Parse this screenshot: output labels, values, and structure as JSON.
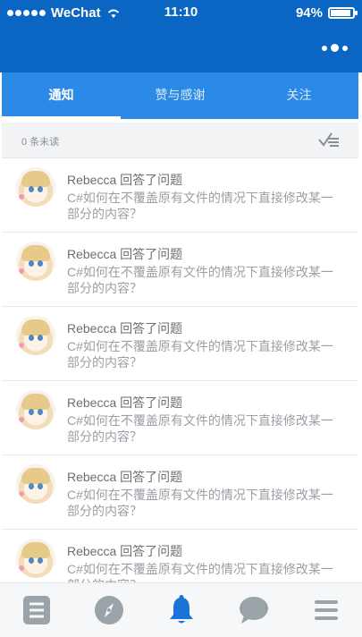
{
  "status_bar": {
    "carrier": "WeChat",
    "time": "11:10",
    "battery": "94%"
  },
  "tabs": [
    {
      "label": "通知",
      "active": true
    },
    {
      "label": "赞与感谢",
      "active": false
    },
    {
      "label": "关注",
      "active": false
    }
  ],
  "unread": {
    "label": "0 条未读"
  },
  "notifications": [
    {
      "title": "Rebecca 回答了问题",
      "content": "C#如何在不覆盖原有文件的情况下直接修改某一部分的内容？"
    },
    {
      "title": "Rebecca 回答了问题",
      "content": "C#如何在不覆盖原有文件的情况下直接修改某一部分的内容？"
    },
    {
      "title": "Rebecca 回答了问题",
      "content": "C#如何在不覆盖原有文件的情况下直接修改某一部分的内容？"
    },
    {
      "title": "Rebecca 回答了问题",
      "content": "C#如何在不覆盖原有文件的情况下直接修改某一部分的内容？"
    },
    {
      "title": "Rebecca 回答了问题",
      "content": "C#如何在不覆盖原有文件的情况下直接修改某一部分的内容？"
    },
    {
      "title": "Rebecca 回答了问题",
      "content": "C#如何在不覆盖原有文件的情况下直接修改某一部分的内容？"
    }
  ],
  "tabbar": [
    {
      "icon": "list-icon",
      "active": false
    },
    {
      "icon": "compass-icon",
      "active": false
    },
    {
      "icon": "bell-icon",
      "active": true
    },
    {
      "icon": "chat-bubble-icon",
      "active": false
    },
    {
      "icon": "menu-icon",
      "active": false
    }
  ],
  "colors": {
    "primary": "#0b66c3",
    "tab_bar": "#2b8ae6",
    "active_icon": "#1a73d9",
    "inactive_icon": "#9aa3a8"
  }
}
